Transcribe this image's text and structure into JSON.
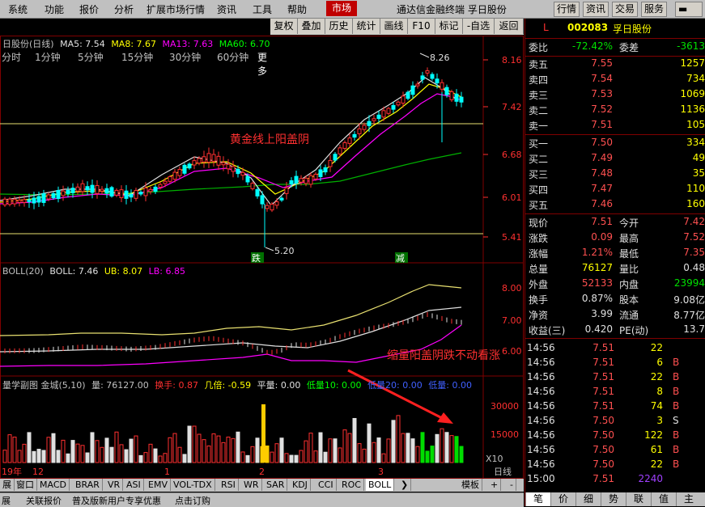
{
  "menubar": {
    "items": [
      "系统",
      "功能",
      "报价",
      "分析",
      "扩展市场行情",
      "资讯",
      "工具",
      "帮助"
    ],
    "market_tab": "市场",
    "title": "通达信金融终端  孚日股份",
    "right_buttons": [
      "行情",
      "资讯",
      "交易",
      "服务"
    ]
  },
  "toolbar2": {
    "periods": [
      "分时",
      "1分钟",
      "5分钟",
      "15分钟",
      "30分钟",
      "60分钟",
      "更多"
    ],
    "buttons": [
      "复权",
      "叠加",
      "历史",
      "统计",
      "画线",
      "F10",
      "标记",
      "-自选",
      "返回"
    ]
  },
  "main_chart": {
    "legend_title": "日股份(日线)",
    "ma5": "MA5: 7.54",
    "ma8": "MA8: 7.67",
    "ma13": "MA13: 7.63",
    "ma60": "MA60: 6.70",
    "y_ticks": [
      "8.16",
      "7.42",
      "6.68",
      "6.01",
      "5.41"
    ],
    "high_label": "8.26",
    "low_label": "5.20",
    "annotation_golden": "黄金线上阳盖阴",
    "marker_die": "跌",
    "marker_jian": "减"
  },
  "boll_chart": {
    "legend": "BOLL(20)",
    "boll": "BOLL: 7.46",
    "ub": "UB: 8.07",
    "lb": "LB: 6.85",
    "y_ticks": [
      "8.00",
      "7.00",
      "6.00"
    ],
    "annotation": "缩量阳盖阴跌不动看涨"
  },
  "volume_chart": {
    "legend": "量学副图 金城(5,10)",
    "volume": "量: 76127.00",
    "turnover": "换手: 0.87",
    "ratio": "几倍: -0.59",
    "flat": "平量: 0.00",
    "low10": "低量10: 0.00",
    "low20": "低量20: 0.00",
    "lowest": "低量: 0.00",
    "y_ticks": [
      "30000",
      "15000"
    ],
    "unit": "X10",
    "date_labels": [
      "19年",
      "12",
      "1",
      "2",
      "3"
    ],
    "period": "日线"
  },
  "bottom_tabs": [
    "展",
    "窗口",
    "MACD",
    "BRAR",
    "VR",
    "ASI",
    "EMV",
    "VOL-TDX",
    "RSI",
    "WR",
    "SAR",
    "KDJ",
    "CCI",
    "ROC",
    "BOLL"
  ],
  "bottom_right": [
    "模板",
    "+",
    "-"
  ],
  "statusbar": [
    "展",
    "关联报价",
    "普及版新用户专享优惠",
    "点击订购"
  ],
  "quote": {
    "header_l": "L",
    "code": "002083",
    "name": "孚日股份",
    "weibi_label": "委比",
    "weibi": "-72.42%",
    "weicha_label": "委差",
    "weicha": "-3613",
    "asks": [
      {
        "label": "卖五",
        "price": "7.55",
        "vol": "1257"
      },
      {
        "label": "卖四",
        "price": "7.54",
        "vol": "734"
      },
      {
        "label": "卖三",
        "price": "7.53",
        "vol": "1069"
      },
      {
        "label": "卖二",
        "price": "7.52",
        "vol": "1136"
      },
      {
        "label": "卖一",
        "price": "7.51",
        "vol": "105"
      }
    ],
    "bids": [
      {
        "label": "买一",
        "price": "7.50",
        "vol": "334"
      },
      {
        "label": "买二",
        "price": "7.49",
        "vol": "49"
      },
      {
        "label": "买三",
        "price": "7.48",
        "vol": "35"
      },
      {
        "label": "买四",
        "price": "7.47",
        "vol": "110"
      },
      {
        "label": "买五",
        "price": "7.46",
        "vol": "160"
      }
    ],
    "stats": [
      {
        "l1": "现价",
        "v1": "7.51",
        "l2": "今开",
        "v2": "7.42"
      },
      {
        "l1": "涨跌",
        "v1": "0.09",
        "l2": "最高",
        "v2": "7.52"
      },
      {
        "l1": "涨幅",
        "v1": "1.21%",
        "l2": "最低",
        "v2": "7.35"
      },
      {
        "l1": "总量",
        "v1": "76127",
        "l2": "量比",
        "v2": "0.48"
      },
      {
        "l1": "外盘",
        "v1": "52133",
        "l2": "内盘",
        "v2": "23994"
      },
      {
        "l1": "换手",
        "v1": "0.87%",
        "l2": "股本",
        "v2": "9.08亿"
      },
      {
        "l1": "净资",
        "v1": "3.99",
        "l2": "流通",
        "v2": "8.77亿"
      },
      {
        "l1": "收益(三)",
        "v1": "0.420",
        "l2": "PE(动)",
        "v2": "13.7"
      }
    ],
    "ticks": [
      {
        "t": "14:56",
        "p": "7.51",
        "v": "22",
        "s": ""
      },
      {
        "t": "14:56",
        "p": "7.51",
        "v": "6",
        "s": "B"
      },
      {
        "t": "14:56",
        "p": "7.51",
        "v": "22",
        "s": "B"
      },
      {
        "t": "14:56",
        "p": "7.51",
        "v": "8",
        "s": "B"
      },
      {
        "t": "14:56",
        "p": "7.51",
        "v": "74",
        "s": "B"
      },
      {
        "t": "14:56",
        "p": "7.50",
        "v": "3",
        "s": "S"
      },
      {
        "t": "14:56",
        "p": "7.50",
        "v": "122",
        "s": "B"
      },
      {
        "t": "14:56",
        "p": "7.50",
        "v": "61",
        "s": "B"
      },
      {
        "t": "14:56",
        "p": "7.50",
        "v": "22",
        "s": "B"
      },
      {
        "t": "15:00",
        "p": "7.51",
        "v": "2240",
        "s": ""
      }
    ],
    "bottom_tabs": [
      "笔",
      "价",
      "细",
      "势",
      "联",
      "值",
      "主"
    ]
  }
}
